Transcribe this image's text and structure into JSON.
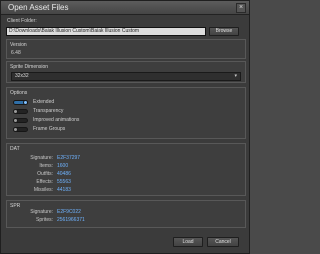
{
  "window": {
    "title": "Open Asset Files",
    "close_symbol": "×"
  },
  "client_folder": {
    "label": "Client Folder:",
    "value": "D:\\Downloads\\Baiak Illusion Custom\\Baiak Illusion Custom",
    "browse_label": "Browse"
  },
  "version": {
    "label": "Version",
    "value": "6.48"
  },
  "sprite_dimension": {
    "label": "Sprite Dimension",
    "value": "32x32",
    "chevron": "▾"
  },
  "options": {
    "label": "Options",
    "items": [
      {
        "label": "Extended",
        "enabled": true
      },
      {
        "label": "Transparency",
        "enabled": false
      },
      {
        "label": "Improved animations",
        "enabled": false
      },
      {
        "label": "Frame Groups",
        "enabled": false
      }
    ]
  },
  "dat": {
    "label": "DAT",
    "rows": [
      {
        "key": "Signature:",
        "value": "E2F37297"
      },
      {
        "key": "Items:",
        "value": "1600"
      },
      {
        "key": "Outfits:",
        "value": "40486"
      },
      {
        "key": "Effects:",
        "value": "55563"
      },
      {
        "key": "Missiles:",
        "value": "44183"
      }
    ]
  },
  "spr": {
    "label": "SPR",
    "rows": [
      {
        "key": "Signature:",
        "value": "E2F9C022"
      },
      {
        "key": "Sprites:",
        "value": "2561966371"
      }
    ]
  },
  "footer": {
    "load_label": "Load",
    "cancel_label": "Cancel"
  }
}
